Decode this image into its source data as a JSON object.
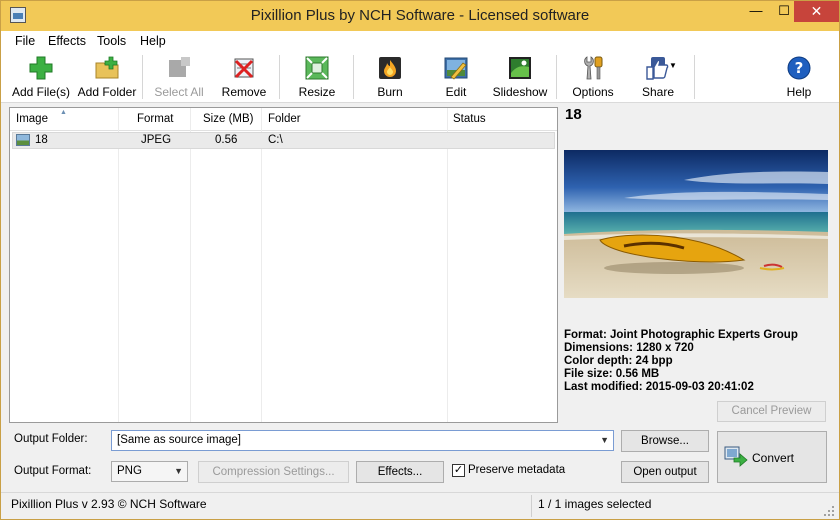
{
  "window": {
    "title": "Pixillion Plus by NCH Software - Licensed software",
    "minimize": "—",
    "maximize": "☐",
    "close": "✕"
  },
  "menu": [
    "File",
    "Effects",
    "Tools",
    "Help"
  ],
  "toolbar": {
    "add_files": "Add File(s)",
    "add_folder": "Add Folder",
    "select_all": "Select All",
    "remove": "Remove",
    "resize": "Resize",
    "burn": "Burn",
    "edit": "Edit",
    "slideshow": "Slideshow",
    "options": "Options",
    "share": "Share",
    "help": "Help"
  },
  "list": {
    "columns": [
      "Image",
      "Format",
      "Size (MB)",
      "Folder",
      "Status"
    ],
    "rows": [
      {
        "image": "18",
        "format": "JPEG",
        "size": "0.56",
        "folder": "C:\\",
        "status": ""
      }
    ]
  },
  "preview": {
    "title": "18",
    "format": "Format: Joint Photographic Experts Group",
    "dimensions": "Dimensions: 1280 x 720",
    "color_depth": "Color depth: 24 bpp",
    "file_size": "File size: 0.56 MB",
    "last_modified": "Last modified: 2015-09-03 20:41:02",
    "cancel_preview": "Cancel Preview"
  },
  "output": {
    "folder_label": "Output Folder:",
    "folder_value": "[Same as source image]",
    "browse": "Browse...",
    "format_label": "Output Format:",
    "format_value": "PNG",
    "compression": "Compression Settings...",
    "effects": "Effects...",
    "preserve_metadata": "Preserve metadata",
    "preserve_checked": "✓",
    "open_output": "Open output",
    "convert": "Convert"
  },
  "status": {
    "left": "Pixillion Plus v 2.93 © NCH Software",
    "right": "1 / 1 images selected"
  },
  "colors": {
    "titlebar": "#f2c957",
    "close_button": "#c7443b"
  }
}
